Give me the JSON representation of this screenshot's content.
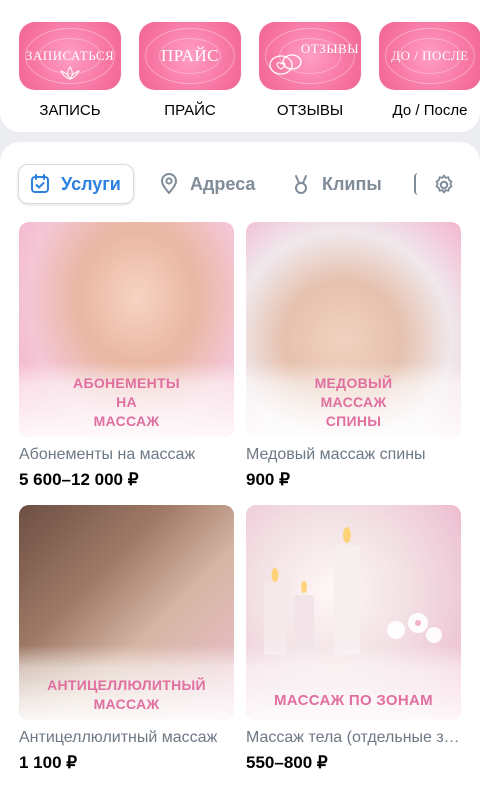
{
  "stories": [
    {
      "tile_text": "ЗАПИСАТЬСЯ",
      "caption": "ЗАПИСЬ"
    },
    {
      "tile_text": "ПРАЙС",
      "caption": "ПРАЙС"
    },
    {
      "tile_text": "ОТЗЫВЫ",
      "caption": "ОТЗЫВЫ"
    },
    {
      "tile_text": "ДО / ПОСЛЕ",
      "caption": "До / После"
    }
  ],
  "tabs": [
    {
      "label": "Услуги",
      "icon": "calendar-check-icon",
      "active": true
    },
    {
      "label": "Адреса",
      "icon": "map-pin-icon",
      "active": false
    },
    {
      "label": "Клипы",
      "icon": "clips-icon",
      "active": false
    }
  ],
  "colors": {
    "accent": "#2d81e0",
    "pink": "#f06595",
    "label_pink": "#e06fa0"
  },
  "products": [
    {
      "image_label": "АБОНЕМЕНТЫ\nНА\nМАССАЖ",
      "name": "Абонементы на массаж",
      "price": "5 600–12 000 ₽"
    },
    {
      "image_label": "МЕДОВЫЙ\nМАССАЖ\nСПИНЫ",
      "name": "Медовый массаж спины",
      "price": "900 ₽"
    },
    {
      "image_label": "АНТИЦЕЛЛЮЛИТНЫЙ\nМАССАЖ",
      "name": "Антицеллюлитный массаж",
      "price": "1 100 ₽"
    },
    {
      "image_label": "МАССАЖ ПО ЗОНАМ",
      "name": "Массаж тела (отдельные зоны)",
      "price": "550–800 ₽"
    }
  ]
}
